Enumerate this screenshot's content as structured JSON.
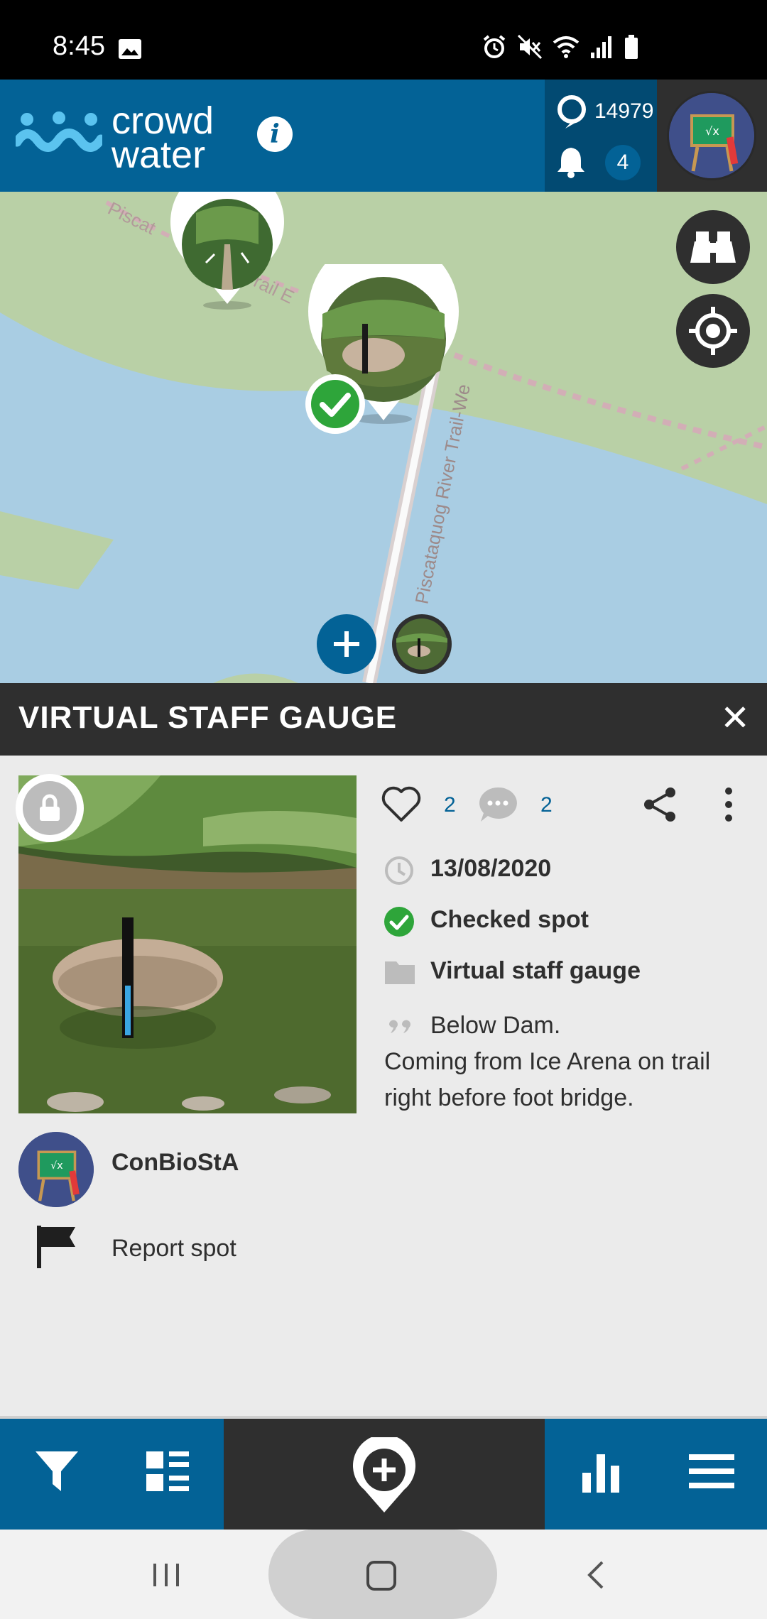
{
  "status_bar": {
    "time": "8:45",
    "icons": [
      "image-icon",
      "alarm-icon",
      "mute-icon",
      "wifi-icon",
      "signal-icon",
      "battery-icon"
    ]
  },
  "app_bar": {
    "logo_line1": "crowd",
    "logo_line2": "water",
    "info_label": "i",
    "score": "14979",
    "notifications": "4",
    "colors": {
      "primary": "#036296",
      "dark": "#2f2f2f",
      "stats_bg": "#024a72"
    }
  },
  "map": {
    "trail_labels": [
      "Piscataquog River Trail-We",
      "Piscat",
      "rail E"
    ],
    "colors": {
      "land": "#b9d0a6",
      "water": "#a9cde3",
      "trail": "#d9b3b3",
      "check": "#2ea53a"
    }
  },
  "sheet": {
    "title": "VIRTUAL STAFF GAUGE",
    "close": "✕",
    "likes": "2",
    "comments": "2",
    "date": "13/08/2020",
    "status": "Checked spot",
    "category": "Virtual staff gauge",
    "comment_line1": "Below Dam.",
    "comment_rest": "Coming from Ice Arena on trail right before foot bridge.",
    "username": "ConBioStA",
    "report": "Report spot"
  },
  "bottom_nav": {
    "items": [
      "filter-icon",
      "list-view-icon",
      "add-spot-icon",
      "statistics-icon",
      "menu-icon"
    ]
  },
  "system_nav": {
    "items": [
      "recents-icon",
      "home-icon",
      "back-icon"
    ]
  }
}
